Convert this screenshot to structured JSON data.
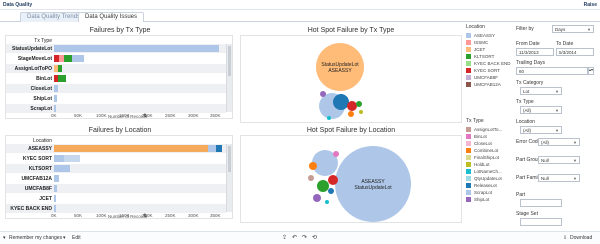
{
  "header": {
    "title": "Data Quality",
    "right_link": "Raise"
  },
  "tabs": [
    {
      "label": "Data Quality Trends",
      "active": false
    },
    {
      "label": "Data Quality Issues",
      "active": true
    }
  ],
  "failures_by_tx": {
    "title": "Failures by Tx Type",
    "column_header": "Tx Type",
    "rows": [
      "StatusUpdateLot",
      "StageMoveLot",
      "AssignLotToPO",
      "BinLot",
      "CloseLot",
      "ShipLot",
      "ScrapLot"
    ],
    "axis_ticks": [
      "0K",
      "50K",
      "100K",
      "150K",
      "200K",
      "250K",
      "300K",
      "350K"
    ],
    "axis_label": "Number of Records"
  },
  "failures_by_location": {
    "title": "Failures by Location",
    "column_header": "Location",
    "rows": [
      "ASEASSY",
      "KYEC SORT",
      "KLTSORT",
      "UMCFAB12A",
      "UMCFAB8F",
      "JCET",
      "KYEC BACK END"
    ],
    "axis_ticks": [
      "0K",
      "50K",
      "100K",
      "150K",
      "200K",
      "250K",
      "300K",
      "350K"
    ],
    "axis_label": "Number of Records"
  },
  "hotspot_tx": {
    "title": "Hot Spot Failure by Tx Type",
    "big_label_1": "StatusUpdateLot",
    "big_label_2": "ASEASSY"
  },
  "hotspot_location": {
    "title": "Hot Spot Failure by Location",
    "big_label_1": "ASEASSY",
    "big_label_2": "StatusUpdateLot"
  },
  "legend_location": {
    "title": "Location",
    "items": [
      {
        "label": "ASEASSY",
        "color": "#aec7e8"
      },
      {
        "label": "ISSMC",
        "color": "#ff9896"
      },
      {
        "label": "JCET",
        "color": "#ffbb78"
      },
      {
        "label": "KLTSORT",
        "color": "#2ca02c"
      },
      {
        "label": "KYEC BACK END",
        "color": "#98df8a"
      },
      {
        "label": "KYEC SORT",
        "color": "#d62728"
      },
      {
        "label": "UMCFAB8F",
        "color": "#c5b0d5"
      },
      {
        "label": "UMCFAB12A",
        "color": "#8c564b"
      }
    ]
  },
  "legend_tx": {
    "title": "Tx Type",
    "items": [
      {
        "label": "AssignLotTo...",
        "color": "#c49c94"
      },
      {
        "label": "BinLot",
        "color": "#e377c2"
      },
      {
        "label": "CloseLot",
        "color": "#f7b6d2"
      },
      {
        "label": "CombineLot",
        "color": "#ff7f0e"
      },
      {
        "label": "FinalShipLot",
        "color": "#dbdb8d"
      },
      {
        "label": "HoldLot",
        "color": "#bcbd22"
      },
      {
        "label": "LotNameCh...",
        "color": "#17becf"
      },
      {
        "label": "QtyUpdateLot",
        "color": "#9edae5"
      },
      {
        "label": "ReleaseLot",
        "color": "#1f77b4"
      },
      {
        "label": "ScrapLot",
        "color": "#aec7e8"
      },
      {
        "label": "ShipLot",
        "color": "#9467bd"
      }
    ]
  },
  "filters": {
    "filter_by_label": "Filter by",
    "filter_by_value": "Days",
    "from_label": "From Date",
    "from_value": "11/3/2013",
    "to_label": "To Date",
    "to_value": "5/3/2014",
    "trailing_label": "Trailing Days",
    "trailing_value": "60",
    "tx_category_label": "Tx Category",
    "tx_category_value": "Lot",
    "tx_type_label": "Tx Type",
    "tx_type_value": "(All)",
    "location_label": "Location",
    "location_value": "(All)",
    "error_code_label": "Error Code",
    "error_code_value": "(All)",
    "part_group_label": "Part Group",
    "part_group_value": "Null",
    "part_family_label": "Part Family",
    "part_family_value": "Null",
    "part_label": "Part",
    "part_value": "",
    "stage_set_label": "Stage Set",
    "stage_set_value": ""
  },
  "bottom": {
    "remember": "Remember my changes",
    "edit": "Edit",
    "download": "Download"
  }
}
